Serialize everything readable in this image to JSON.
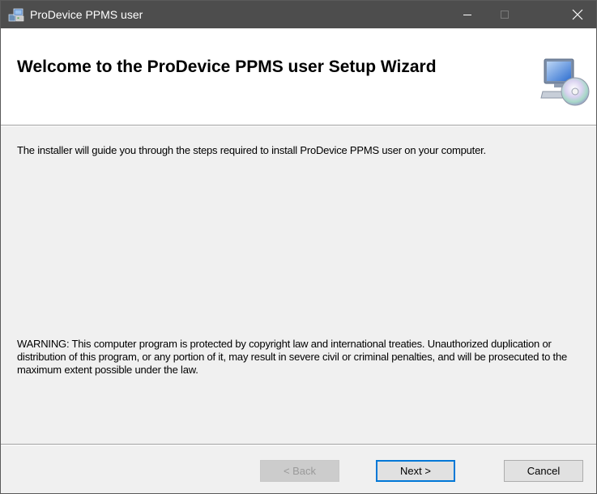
{
  "window": {
    "title": "ProDevice PPMS user",
    "minimize_glyph": "—",
    "close_glyph": "✕"
  },
  "header": {
    "title": "Welcome to the ProDevice PPMS user Setup Wizard",
    "icon": "computer-cd-icon"
  },
  "body": {
    "intro": "The installer will guide you through the steps required to install ProDevice PPMS user on your computer.",
    "warning": "WARNING: This computer program is protected by copyright law and international treaties. Unauthorized duplication or distribution of this program, or any portion of it, may result in severe civil or criminal penalties, and will be prosecuted to the maximum extent possible under the law."
  },
  "buttons": {
    "back": "< Back",
    "next": "Next >",
    "cancel": "Cancel"
  },
  "colors": {
    "titlebar": "#4d4d4d",
    "focus_border": "#0078d7",
    "panel_bg": "#f0f0f0"
  }
}
